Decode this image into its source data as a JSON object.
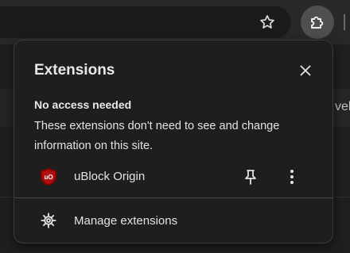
{
  "toolbar": {
    "bookmark_icon": "star-outline-icon",
    "extensions_icon": "puzzle-icon"
  },
  "background": {
    "peek_text": "velc"
  },
  "popup": {
    "title": "Extensions",
    "close_icon": "close-icon",
    "section": {
      "heading": "No access needed",
      "description": "These extensions don't need to see and change information on this site."
    },
    "extensions": [
      {
        "name": "uBlock Origin",
        "icon": "ublock-origin-icon",
        "pin_icon": "pin-icon",
        "menu_icon": "more-vert-icon"
      }
    ],
    "manage": {
      "label": "Manage extensions",
      "icon": "gear-icon"
    }
  },
  "colors": {
    "popup_bg": "#1e1e1e",
    "toolbar_bg": "#282828",
    "active_button_bg": "#4f4f4f",
    "text": "#e3e3e3",
    "ublock_red": "#800000"
  }
}
